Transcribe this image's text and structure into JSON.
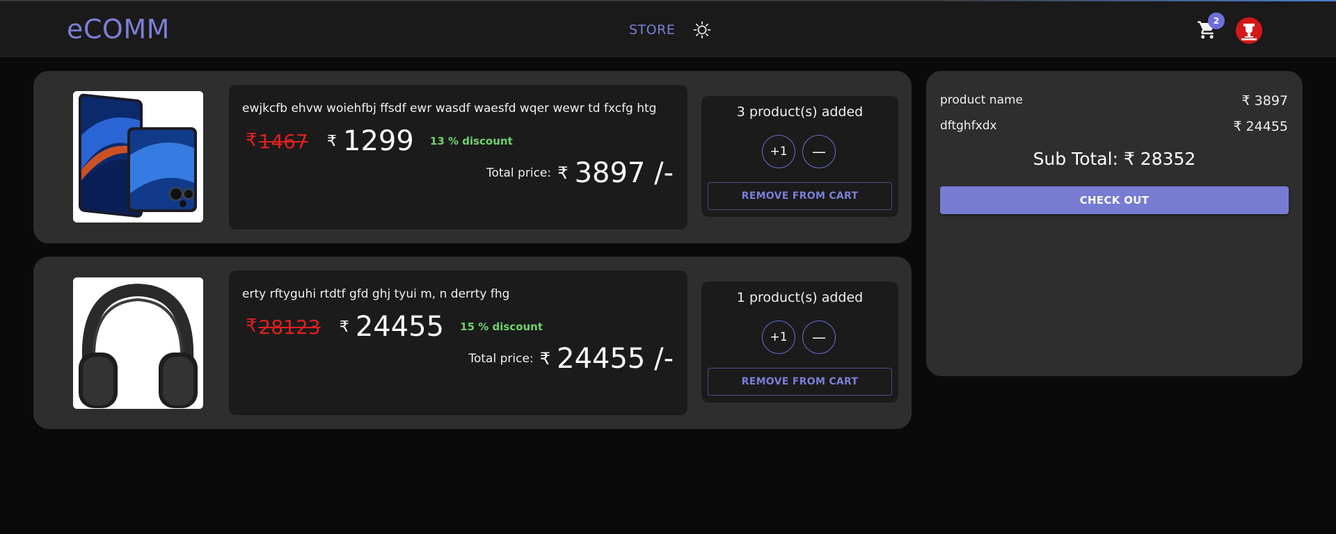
{
  "header": {
    "logo": "eCOMM",
    "nav_store": "STORE",
    "cart_count": "2",
    "theme_icon": "sun-icon",
    "cart_icon": "cart-icon",
    "avatar_icon": "dream11-logo",
    "accent_color": "#7b7fd6"
  },
  "cart": {
    "items": [
      {
        "title": "ewjkcfb ehvw woiehfbj ffsdf ewr wasdf waesfd wqer wewr td fxcfg htg",
        "currency": "₹",
        "old_price": "1467",
        "new_price": "1299",
        "discount": "13 % discount",
        "total_label": "Total price:",
        "total_value": "3897 /-",
        "qty_label": "3 product(s) added",
        "plus_label": "+1",
        "minus_label": "—",
        "remove_label": "REMOVE FROM CART"
      },
      {
        "title": "erty rftyguhi rtdtf gfd ghj tyui m, n derrty fhg",
        "currency": "₹",
        "old_price": "28123",
        "new_price": "24455",
        "discount": "15 % discount",
        "total_label": "Total price:",
        "total_value": "24455 /-",
        "qty_label": "1 product(s) added",
        "plus_label": "+1",
        "minus_label": "—",
        "remove_label": "REMOVE FROM CART"
      }
    ]
  },
  "summary": {
    "rows": [
      {
        "name": "product name",
        "value": "₹ 3897"
      },
      {
        "name": "dftghfxdx",
        "value": "₹ 24455"
      }
    ],
    "subtotal": "Sub Total: ₹ 28352",
    "checkout_label": "CHECK OUT"
  }
}
